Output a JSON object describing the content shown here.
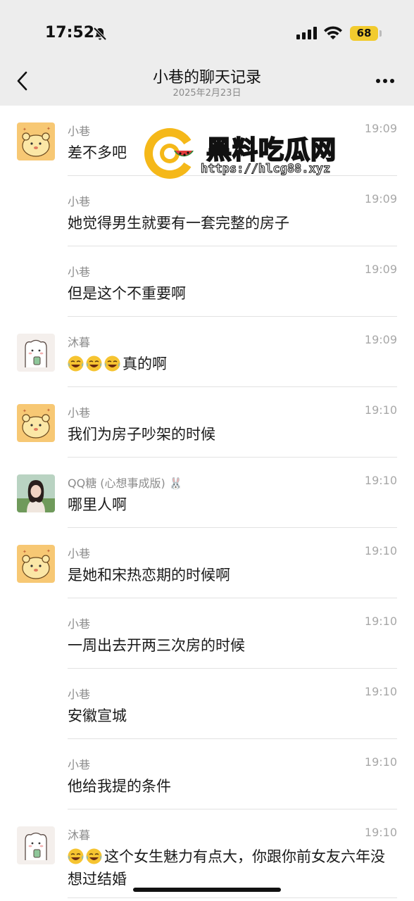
{
  "status_bar": {
    "time": "17:52",
    "battery": "68"
  },
  "nav": {
    "title": "小巷的聊天记录",
    "subtitle": "2025年2月23日"
  },
  "watermark": {
    "title": "黑料吃瓜网",
    "url": "https://hlcg88.xyz"
  },
  "messages": [
    {
      "sender": "小巷",
      "time": "19:09",
      "text": "差不多吧",
      "avatar": "yellow-bear-avatar",
      "emoji": 0
    },
    {
      "sender": "小巷",
      "time": "19:09",
      "text": "她觉得男生就要有一套完整的房子",
      "avatar": "",
      "emoji": 0
    },
    {
      "sender": "小巷",
      "time": "19:09",
      "text": "但是这个不重要啊",
      "avatar": "",
      "emoji": 0
    },
    {
      "sender": "沐暮",
      "time": "19:09",
      "text": "真的啊",
      "avatar": "white-bear-avatar",
      "emoji": 3
    },
    {
      "sender": "小巷",
      "time": "19:10",
      "text": "我们为房子吵架的时候",
      "avatar": "yellow-bear-avatar",
      "emoji": 0
    },
    {
      "sender": "QQ糖 (心想事成版) 🐰",
      "time": "19:10",
      "text": "哪里人啊",
      "avatar": "photo-avatar",
      "emoji": 0
    },
    {
      "sender": "小巷",
      "time": "19:10",
      "text": "是她和宋热恋期的时候啊",
      "avatar": "yellow-bear-avatar",
      "emoji": 0
    },
    {
      "sender": "小巷",
      "time": "19:10",
      "text": "一周出去开两三次房的时候",
      "avatar": "",
      "emoji": 0
    },
    {
      "sender": "小巷",
      "time": "19:10",
      "text": "安徽宣城",
      "avatar": "",
      "emoji": 0
    },
    {
      "sender": "小巷",
      "time": "19:10",
      "text": "他给我提的条件",
      "avatar": "",
      "emoji": 0
    },
    {
      "sender": "沐暮",
      "time": "19:10",
      "text": "这个女生魅力有点大，你跟你前女友六年没想过结婚",
      "avatar": "white-bear-avatar",
      "emoji": 2
    }
  ],
  "colors": {
    "header_bg": "#ededed",
    "divider": "#e2e2e2",
    "meta_text": "#8c8c8c",
    "battery": "#f2cb2e"
  }
}
